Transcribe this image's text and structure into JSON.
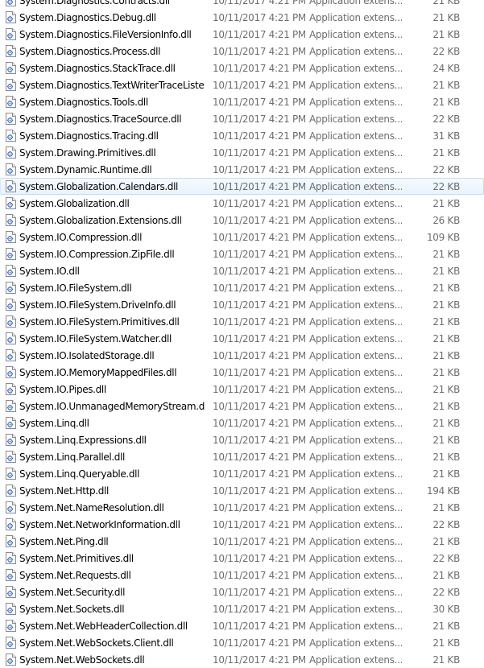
{
  "files": [
    {
      "name": "System.Diagnostics.Contracts.dll",
      "date": "10/11/2017 4:21 PM",
      "type": "Application extens...",
      "size": "21 KB"
    },
    {
      "name": "System.Diagnostics.Debug.dll",
      "date": "10/11/2017 4:21 PM",
      "type": "Application extens...",
      "size": "21 KB"
    },
    {
      "name": "System.Diagnostics.FileVersionInfo.dll",
      "date": "10/11/2017 4:21 PM",
      "type": "Application extens...",
      "size": "21 KB"
    },
    {
      "name": "System.Diagnostics.Process.dll",
      "date": "10/11/2017 4:21 PM",
      "type": "Application extens...",
      "size": "22 KB"
    },
    {
      "name": "System.Diagnostics.StackTrace.dll",
      "date": "10/11/2017 4:21 PM",
      "type": "Application extens...",
      "size": "24 KB"
    },
    {
      "name": "System.Diagnostics.TextWriterTraceListe...",
      "date": "10/11/2017 4:21 PM",
      "type": "Application extens...",
      "size": "21 KB"
    },
    {
      "name": "System.Diagnostics.Tools.dll",
      "date": "10/11/2017 4:21 PM",
      "type": "Application extens...",
      "size": "21 KB"
    },
    {
      "name": "System.Diagnostics.TraceSource.dll",
      "date": "10/11/2017 4:21 PM",
      "type": "Application extens...",
      "size": "22 KB"
    },
    {
      "name": "System.Diagnostics.Tracing.dll",
      "date": "10/11/2017 4:21 PM",
      "type": "Application extens...",
      "size": "31 KB"
    },
    {
      "name": "System.Drawing.Primitives.dll",
      "date": "10/11/2017 4:21 PM",
      "type": "Application extens...",
      "size": "21 KB"
    },
    {
      "name": "System.Dynamic.Runtime.dll",
      "date": "10/11/2017 4:21 PM",
      "type": "Application extens...",
      "size": "22 KB"
    },
    {
      "name": "System.Globalization.Calendars.dll",
      "date": "10/11/2017 4:21 PM",
      "type": "Application extens...",
      "size": "22 KB",
      "hovered": true
    },
    {
      "name": "System.Globalization.dll",
      "date": "10/11/2017 4:21 PM",
      "type": "Application extens...",
      "size": "21 KB"
    },
    {
      "name": "System.Globalization.Extensions.dll",
      "date": "10/11/2017 4:21 PM",
      "type": "Application extens...",
      "size": "26 KB"
    },
    {
      "name": "System.IO.Compression.dll",
      "date": "10/11/2017 4:21 PM",
      "type": "Application extens...",
      "size": "109 KB"
    },
    {
      "name": "System.IO.Compression.ZipFile.dll",
      "date": "10/11/2017 4:21 PM",
      "type": "Application extens...",
      "size": "21 KB"
    },
    {
      "name": "System.IO.dll",
      "date": "10/11/2017 4:21 PM",
      "type": "Application extens...",
      "size": "21 KB"
    },
    {
      "name": "System.IO.FileSystem.dll",
      "date": "10/11/2017 4:21 PM",
      "type": "Application extens...",
      "size": "21 KB"
    },
    {
      "name": "System.IO.FileSystem.DriveInfo.dll",
      "date": "10/11/2017 4:21 PM",
      "type": "Application extens...",
      "size": "21 KB"
    },
    {
      "name": "System.IO.FileSystem.Primitives.dll",
      "date": "10/11/2017 4:21 PM",
      "type": "Application extens...",
      "size": "21 KB"
    },
    {
      "name": "System.IO.FileSystem.Watcher.dll",
      "date": "10/11/2017 4:21 PM",
      "type": "Application extens...",
      "size": "21 KB"
    },
    {
      "name": "System.IO.IsolatedStorage.dll",
      "date": "10/11/2017 4:21 PM",
      "type": "Application extens...",
      "size": "21 KB"
    },
    {
      "name": "System.IO.MemoryMappedFiles.dll",
      "date": "10/11/2017 4:21 PM",
      "type": "Application extens...",
      "size": "21 KB"
    },
    {
      "name": "System.IO.Pipes.dll",
      "date": "10/11/2017 4:21 PM",
      "type": "Application extens...",
      "size": "21 KB"
    },
    {
      "name": "System.IO.UnmanagedMemoryStream.dll",
      "date": "10/11/2017 4:21 PM",
      "type": "Application extens...",
      "size": "21 KB"
    },
    {
      "name": "System.Linq.dll",
      "date": "10/11/2017 4:21 PM",
      "type": "Application extens...",
      "size": "21 KB"
    },
    {
      "name": "System.Linq.Expressions.dll",
      "date": "10/11/2017 4:21 PM",
      "type": "Application extens...",
      "size": "21 KB"
    },
    {
      "name": "System.Linq.Parallel.dll",
      "date": "10/11/2017 4:21 PM",
      "type": "Application extens...",
      "size": "21 KB"
    },
    {
      "name": "System.Linq.Queryable.dll",
      "date": "10/11/2017 4:21 PM",
      "type": "Application extens...",
      "size": "21 KB"
    },
    {
      "name": "System.Net.Http.dll",
      "date": "10/11/2017 4:21 PM",
      "type": "Application extens...",
      "size": "194 KB"
    },
    {
      "name": "System.Net.NameResolution.dll",
      "date": "10/11/2017 4:21 PM",
      "type": "Application extens...",
      "size": "21 KB"
    },
    {
      "name": "System.Net.NetworkInformation.dll",
      "date": "10/11/2017 4:21 PM",
      "type": "Application extens...",
      "size": "22 KB"
    },
    {
      "name": "System.Net.Ping.dll",
      "date": "10/11/2017 4:21 PM",
      "type": "Application extens...",
      "size": "21 KB"
    },
    {
      "name": "System.Net.Primitives.dll",
      "date": "10/11/2017 4:21 PM",
      "type": "Application extens...",
      "size": "22 KB"
    },
    {
      "name": "System.Net.Requests.dll",
      "date": "10/11/2017 4:21 PM",
      "type": "Application extens...",
      "size": "21 KB"
    },
    {
      "name": "System.Net.Security.dll",
      "date": "10/11/2017 4:21 PM",
      "type": "Application extens...",
      "size": "22 KB"
    },
    {
      "name": "System.Net.Sockets.dll",
      "date": "10/11/2017 4:21 PM",
      "type": "Application extens...",
      "size": "30 KB"
    },
    {
      "name": "System.Net.WebHeaderCollection.dll",
      "date": "10/11/2017 4:21 PM",
      "type": "Application extens...",
      "size": "21 KB"
    },
    {
      "name": "System.Net.WebSockets.Client.dll",
      "date": "10/11/2017 4:21 PM",
      "type": "Application extens...",
      "size": "21 KB"
    },
    {
      "name": "System.Net.WebSockets.dll",
      "date": "10/11/2017 4:21 PM",
      "type": "Application extens...",
      "size": "21 KB"
    }
  ],
  "icon": "dll-file-icon",
  "colors": {
    "name_text": "#000000",
    "meta_text": "#6d6d6d",
    "hover_border": "#c3dcf4",
    "hover_fill": "#eef5fd",
    "icon_accent": "#3a6fc2"
  }
}
